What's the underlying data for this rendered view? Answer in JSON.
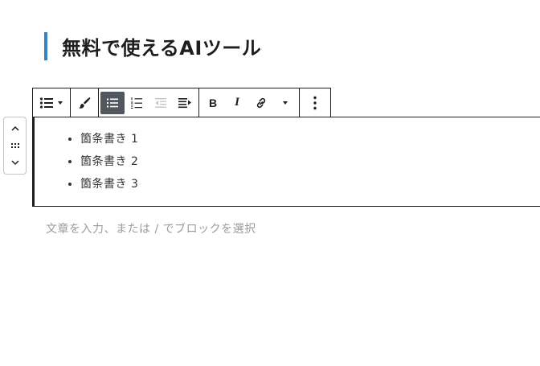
{
  "heading": {
    "text": "無料で使えるAIツール"
  },
  "toolbar": {
    "list_type_icon": "list-bullets-icon",
    "style_icon": "brush-icon",
    "unordered_list_icon": "unordered-list-icon",
    "ordered_list_icon": "ordered-list-icon",
    "outdent_icon": "outdent-icon",
    "indent_icon": "indent-icon",
    "bold_label": "B",
    "italic_label": "I",
    "link_icon": "link-icon",
    "more_rich_text_icon": "chevron-down-icon",
    "options_icon": "more-vertical-icon"
  },
  "list": {
    "items": [
      "箇条書き 1",
      "箇条書き 2",
      "箇条書き 3"
    ]
  },
  "mover": {
    "up_icon": "chevron-up-icon",
    "drag_icon": "drag-handle-icon",
    "down_icon": "chevron-down-icon"
  },
  "placeholder": {
    "text": "文章を入力、または / でブロックを選択"
  },
  "colors": {
    "heading_accent": "#3582c4",
    "active_button_bg": "#50575e",
    "border": "#1e1e1e",
    "placeholder_text": "#9a9a9a"
  }
}
